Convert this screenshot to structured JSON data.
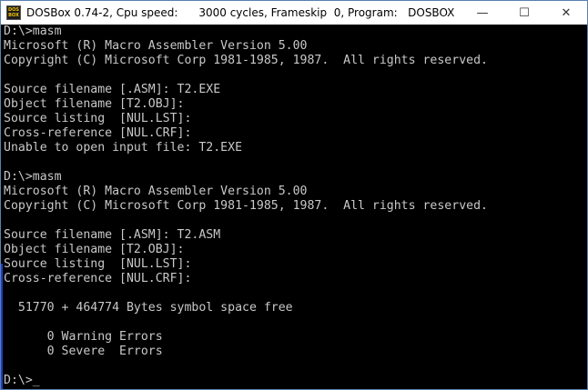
{
  "window": {
    "title": "DOSBox 0.74-2, Cpu speed:      3000 cycles, Frameskip  0, Program:   DOSBOX",
    "icon_text": [
      "DOS",
      "BOX"
    ],
    "buttons": {
      "minimize": "—",
      "maximize": "☐",
      "close": "✕"
    }
  },
  "terminal": {
    "lines": [
      "D:\\>masm",
      "Microsoft (R) Macro Assembler Version 5.00",
      "Copyright (C) Microsoft Corp 1981-1985, 1987.  All rights reserved.",
      "",
      "Source filename [.ASM]: T2.EXE",
      "Object filename [T2.OBJ]:",
      "Source listing  [NUL.LST]:",
      "Cross-reference [NUL.CRF]:",
      "Unable to open input file: T2.EXE",
      "",
      "D:\\>masm",
      "Microsoft (R) Macro Assembler Version 5.00",
      "Copyright (C) Microsoft Corp 1981-1985, 1987.  All rights reserved.",
      "",
      "Source filename [.ASM]: T2.ASM",
      "Object filename [T2.OBJ]:",
      "Source listing  [NUL.LST]:",
      "Cross-reference [NUL.CRF]:",
      "",
      "  51770 + 464774 Bytes symbol space free",
      "",
      "      0 Warning Errors",
      "      0 Severe  Errors",
      "",
      "D:\\>_"
    ]
  },
  "colors": {
    "terminal_bg": "#000000",
    "terminal_fg": "#c8c8c8",
    "titlebar_bg": "#ffffff"
  }
}
